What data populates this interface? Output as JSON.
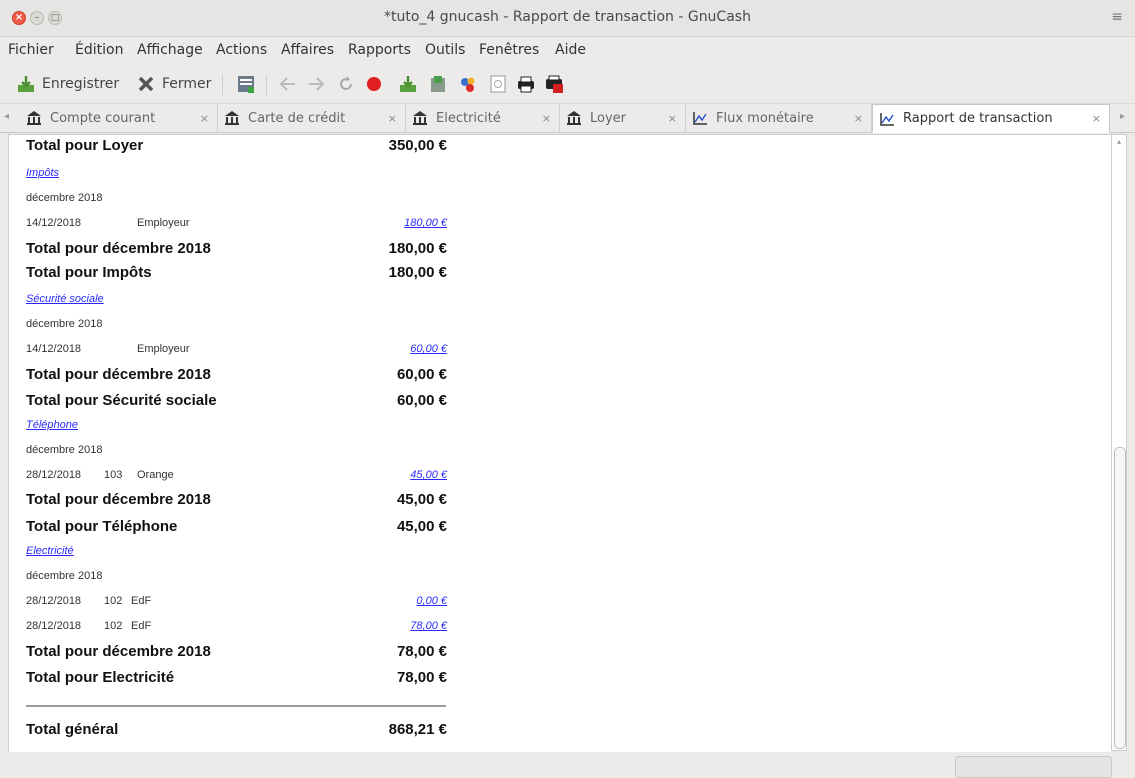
{
  "window": {
    "title": "*tuto_4 gnucash - Rapport de transaction - GnuCash",
    "close_glyph": "×",
    "min_glyph": "–",
    "max_glyph": "□",
    "menu_glyph": "≡"
  },
  "menubar": [
    "Fichier",
    "Édition",
    "Affichage",
    "Actions",
    "Affaires",
    "Rapports",
    "Outils",
    "Fenêtres",
    "Aide"
  ],
  "toolbar": {
    "save_label": "Enregistrer",
    "close_label": "Fermer"
  },
  "tabs": [
    {
      "label": "Compte courant",
      "icon": "bank-icon",
      "close": "×"
    },
    {
      "label": "Carte de crédit",
      "icon": "bank-icon",
      "close": "×"
    },
    {
      "label": "Electricité",
      "icon": "bank-icon",
      "close": "×"
    },
    {
      "label": "Loyer",
      "icon": "bank-icon",
      "close": "×"
    },
    {
      "label": "Flux monétaire",
      "icon": "chart-icon",
      "close": "×"
    },
    {
      "label": "Rapport de transaction",
      "icon": "chart-icon",
      "close": "×",
      "active": true
    }
  ],
  "report": {
    "total_loyer": {
      "label": "Total pour Loyer",
      "amount": "350,00 €"
    },
    "impots": {
      "account": "Impôts",
      "month": "décembre 2018",
      "tx": {
        "date": "14/12/2018",
        "num": "",
        "desc": "Employeur",
        "amount": "180,00 €"
      },
      "month_total": {
        "label": "Total pour décembre 2018",
        "amount": "180,00 €"
      },
      "account_total": {
        "label": "Total pour Impôts",
        "amount": "180,00 €"
      }
    },
    "secu": {
      "account": "Sécurité sociale",
      "month": "décembre 2018",
      "tx": {
        "date": "14/12/2018",
        "num": "",
        "desc": "Employeur",
        "amount": "60,00 €"
      },
      "month_total": {
        "label": "Total pour décembre 2018",
        "amount": "60,00 €"
      },
      "account_total": {
        "label": "Total pour Sécurité sociale",
        "amount": "60,00 €"
      }
    },
    "telephone": {
      "account": "Téléphone",
      "month": "décembre 2018",
      "tx": {
        "date": "28/12/2018",
        "num": "103",
        "desc": "Orange",
        "amount": "45,00 €"
      },
      "month_total": {
        "label": "Total pour décembre 2018",
        "amount": "45,00 €"
      },
      "account_total": {
        "label": "Total pour Téléphone",
        "amount": "45,00 €"
      }
    },
    "electricite": {
      "account": "Electricité",
      "month": "décembre 2018",
      "tx1": {
        "date": "28/12/2018",
        "num": "102",
        "desc": "EdF",
        "amount": "0,00 €"
      },
      "tx2": {
        "date": "28/12/2018",
        "num": "102",
        "desc": "EdF",
        "amount": "78,00 €"
      },
      "month_total": {
        "label": "Total pour décembre 2018",
        "amount": "78,00 €"
      },
      "account_total": {
        "label": "Total pour Electricité",
        "amount": "78,00 €"
      }
    },
    "grand_total": {
      "label": "Total général",
      "amount": "868,21 €"
    }
  }
}
